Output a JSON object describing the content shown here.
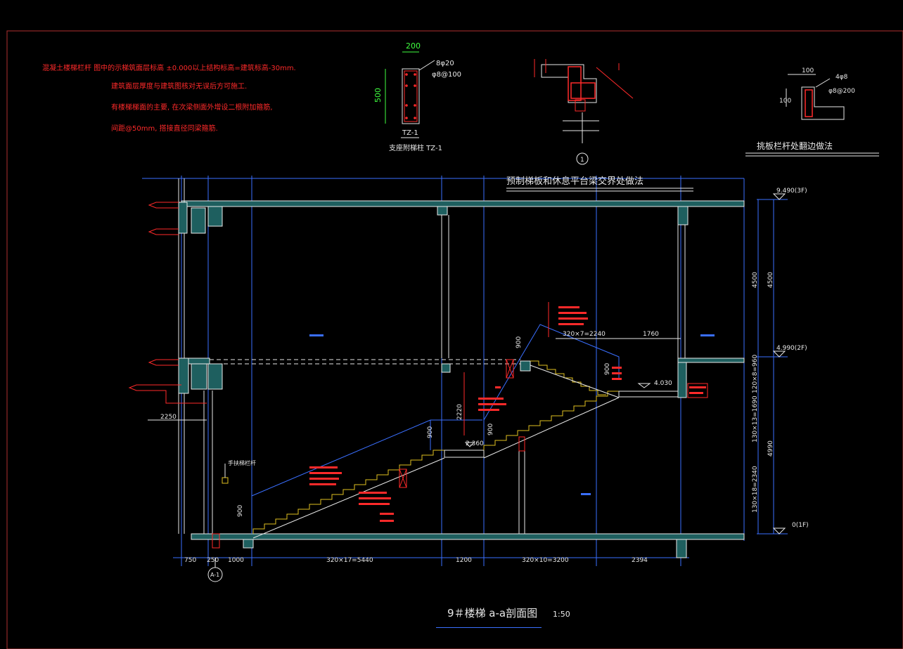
{
  "title": {
    "main": "9＃楼梯 a-a剖面图",
    "scale": "1:50"
  },
  "notes": [
    "混凝土楼梯栏杆 图中的示梯筑面层标高 ±0.000以上结构标高=建筑标高-30mm.",
    "建筑面层厚度与建筑图核对无误后方可施工.",
    "有楼梯梯面的主要, 在次梁侧面外增设二根附加箍筋,",
    "间距@50mm, 搭接直径同梁箍筋."
  ],
  "details": {
    "column_section": {
      "label": "TZ-1",
      "caption": "支座附梯柱 TZ-1",
      "dim_top": "200",
      "dim_side": "500",
      "rebar1": "8φ20",
      "rebar2": "φ8@100"
    },
    "node_title": "预制梯板和休息平台梁交界处做法",
    "node_number": "1",
    "edge_detail": {
      "caption": "挑板栏杆处翻边做法",
      "dim1": "100",
      "dim2": "100",
      "rebar1": "4φ8",
      "rebar2": "φ8@200"
    }
  },
  "levels": {
    "top": "9.490(3F)",
    "mid": "4.990(2F)",
    "bottom": "0(1F)",
    "landing_right": "4.030",
    "landing_mid": "2.360"
  },
  "vertical_dims": [
    "4500",
    "4500",
    "120×8=960",
    "130×13=1690",
    "4990",
    "130×18=2340"
  ],
  "horizontal_dims": [
    "750",
    "250",
    "1000",
    "320×17=5440",
    "1200",
    "320×10=3200",
    "2394"
  ],
  "upper_dims": {
    "flight": "320×7=2240",
    "landing": "1760"
  },
  "other_dims": {
    "h900a": "900",
    "h900b": "900",
    "h900c": "900",
    "h2220": "2220",
    "h900d": "900",
    "w2250": "2250"
  },
  "axis_tag": "A-1",
  "handrail_label": "手扶梯栏杆",
  "colors": {
    "concrete": "#1e5f5f",
    "line_white": "#e8e8e8",
    "dim_blue": "#3a6fff",
    "annot_red": "#ff2a2a",
    "stair_yellow": "#e0c020",
    "border_red": "#b03030"
  }
}
